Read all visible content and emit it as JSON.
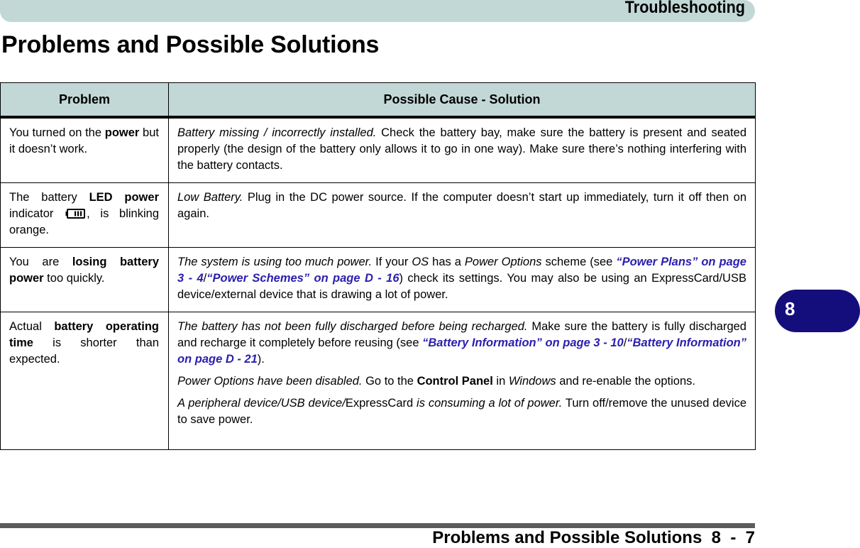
{
  "header": {
    "chapter_title": "Troubleshooting"
  },
  "page_title": "Problems and Possible Solutions",
  "table": {
    "columns": [
      "Problem",
      "Possible Cause - Solution"
    ],
    "rows": [
      {
        "problem": {
          "pre": "You turned on the ",
          "bold": "power",
          "post": " but it doesn’t work."
        },
        "solution": {
          "cause": "Battery missing / incorrectly installed.",
          "text": " Check the battery bay, make sure the battery is present and seated properly (the design of the battery only allows it to go in one way). Make sure there’s nothing interfering with the battery contacts."
        }
      },
      {
        "problem": {
          "pre": "The battery ",
          "bold": "LED power",
          "mid": " indicator ",
          "icon": "battery-icon",
          "post": ", is blinking orange."
        },
        "solution": {
          "cause": "Low Battery.",
          "text": " Plug in the DC power source. If the computer doesn’t start up immediately, turn it off then on again."
        }
      },
      {
        "problem": {
          "pre": "You are ",
          "bold": "losing battery power",
          "post": " too quickly."
        },
        "solution": {
          "cause": "The system is using too much power.",
          "t1": " If your ",
          "os": "OS",
          "t2": " has a ",
          "power_options": "Power Options",
          "t3": " scheme (see ",
          "link1": "“Power Plans” on page 3 - 4",
          "slash": "/",
          "link2": "“Power Schemes” on page D - 16",
          "t4": ") check its settings. You may also be using an ExpressCard/USB device/external device that is drawing a lot of power."
        }
      },
      {
        "problem": {
          "pre": "Actual ",
          "bold": "battery operating time",
          "post": " is shorter than expected."
        },
        "solution": {
          "p1": {
            "cause": "The battery has not been fully discharged before being recharged.",
            "t1": " Make sure the battery is fully discharged and recharge it completely before reusing (see ",
            "link1": "“Battery Information” on page 3 - 10",
            "slash": "/",
            "link2": "“Battery Information” on page D - 21",
            "t2": ")."
          },
          "p2": {
            "cause": "Power Options have been disabled.",
            "t1": " Go to the ",
            "bold": "Control Panel",
            "t2": " in ",
            "italic": "Windows",
            "t3": " and re-enable the options."
          },
          "p3": {
            "italic1": "A peripheral device/USB device/",
            "plain": "ExpressCard",
            "italic2": " is consuming a lot of power.",
            "t1": " Turn off/remove the unused device to save power."
          }
        }
      }
    ]
  },
  "chapter_tab": {
    "label": "8"
  },
  "footer": {
    "text": "Problems and Possible Solutions  8  -  7"
  },
  "colors": {
    "band": "#c2d8d6",
    "link": "#2a1fae",
    "tab": "#140e7c",
    "footer_rule": "#5c5c5c"
  }
}
